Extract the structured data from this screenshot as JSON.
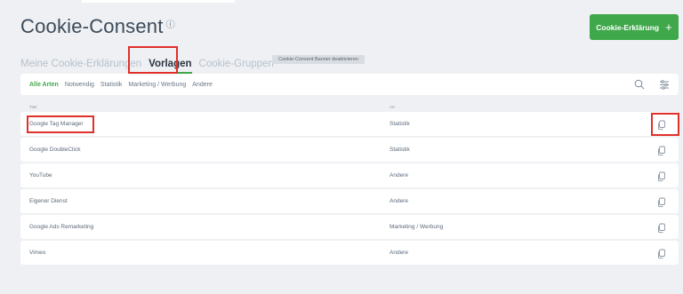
{
  "header": {
    "title": "Cookie-Consent",
    "info_icon": "info-circle-icon",
    "cta_label": "Cookie-Erklärung",
    "cta_icon": "plus"
  },
  "tabs": [
    {
      "label": "Meine Cookie-Erklärungen",
      "active": false
    },
    {
      "label": "Vorlagen",
      "active": true
    },
    {
      "label": "Cookie-Gruppen",
      "active": false
    }
  ],
  "banner_toggle_label": "Cookie-Consent Banner deaktivieren",
  "filters": {
    "items": [
      "Alle Arten",
      "Notwendig",
      "Statistik",
      "Marketing / Werbung",
      "Andere"
    ],
    "active_index": 0,
    "icons": [
      "search-icon",
      "filter-icon"
    ]
  },
  "table": {
    "columns": [
      "Titel",
      "Art"
    ],
    "rows": [
      {
        "title": "Google Tag Manager",
        "type": "Statistik"
      },
      {
        "title": "Google DoubleClick",
        "type": "Statistik"
      },
      {
        "title": "YouTube",
        "type": "Andere"
      },
      {
        "title": "Eigener Dienst",
        "type": "Andere"
      },
      {
        "title": "Google Ads Remarketing",
        "type": "Marketing / Werbung"
      },
      {
        "title": "Vimeo",
        "type": "Andere"
      }
    ],
    "row_action_icon": "copy-icon"
  },
  "colors": {
    "accent": "#3fa84b",
    "highlight": "#e0302a",
    "background": "#eef0f3"
  }
}
